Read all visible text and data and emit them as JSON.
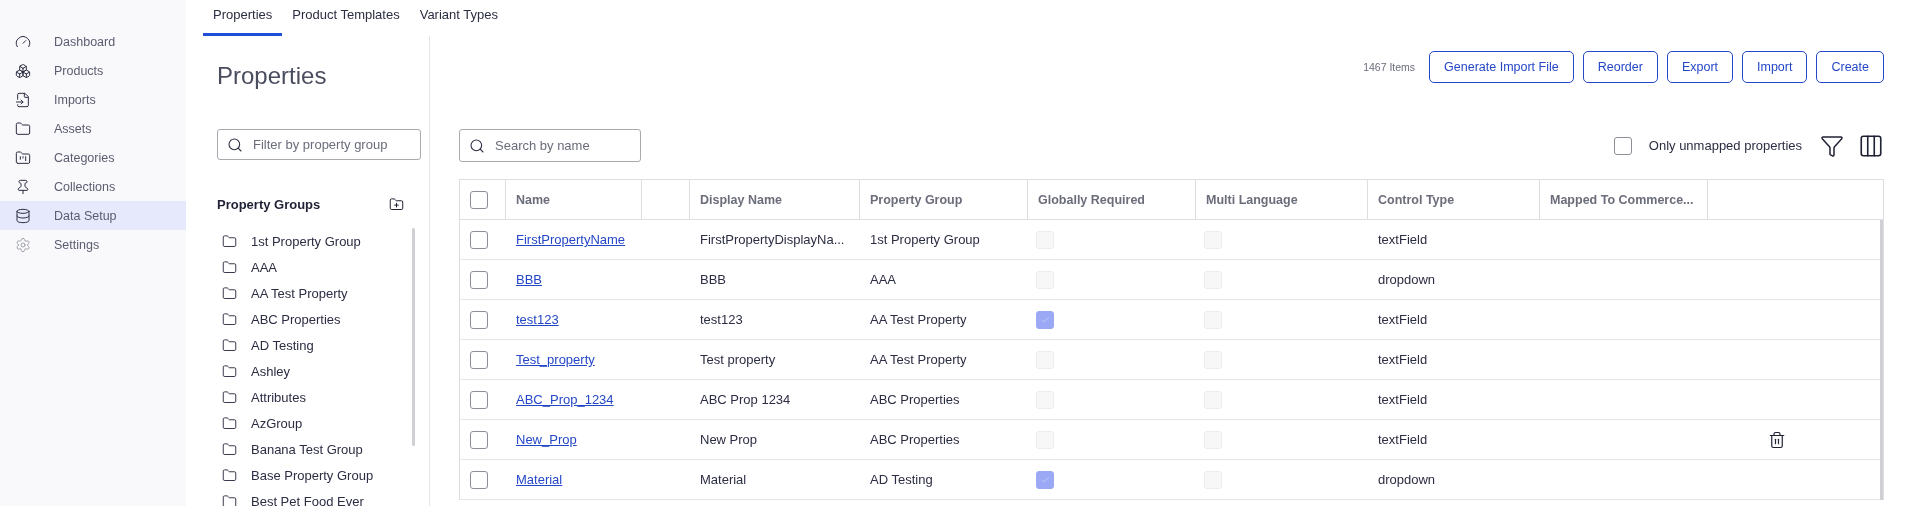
{
  "sidebar": {
    "items": [
      {
        "label": "Dashboard",
        "selected": false
      },
      {
        "label": "Products",
        "selected": false
      },
      {
        "label": "Imports",
        "selected": false
      },
      {
        "label": "Assets",
        "selected": false
      },
      {
        "label": "Categories",
        "selected": false
      },
      {
        "label": "Collections",
        "selected": false
      },
      {
        "label": "Data Setup",
        "selected": true
      },
      {
        "label": "Settings",
        "selected": false
      }
    ]
  },
  "tabs": [
    {
      "label": "Properties",
      "selected": true
    },
    {
      "label": "Product Templates",
      "selected": false
    },
    {
      "label": "Variant Types",
      "selected": false
    }
  ],
  "groups_panel": {
    "title": "Properties",
    "filter": {
      "placeholder": "Filter by property group"
    },
    "heading": "Property Groups",
    "groups": [
      "1st Property Group",
      "AAA",
      "AA Test Property",
      "ABC Properties",
      "AD Testing",
      "Ashley",
      "Attributes",
      "AzGroup",
      "Banana Test Group",
      "Base Property Group",
      "Best Pet Food Ever"
    ]
  },
  "toolbar": {
    "count": "1467 Items",
    "buttons": [
      "Generate Import File",
      "Reorder",
      "Export",
      "Import",
      "Create"
    ]
  },
  "search": {
    "placeholder": "Search by name"
  },
  "unmapped_filter": {
    "label": "Only unmapped properties",
    "checked": false
  },
  "table": {
    "all_selected": false,
    "columns": [
      "Name",
      "Display Name",
      "Property Group",
      "Globally Required",
      "Multi Language",
      "Control Type",
      "Mapped To Commerce..."
    ],
    "rows": [
      {
        "selected": false,
        "name": "FirstPropertyName",
        "display_name": "FirstPropertyDisplayNa...",
        "property_group": "1st Property Group",
        "globally_required": false,
        "multi_language": false,
        "control_type": "textField",
        "show_delete": false
      },
      {
        "selected": false,
        "name": "BBB",
        "display_name": "BBB",
        "property_group": "AAA",
        "globally_required": false,
        "multi_language": false,
        "control_type": "dropdown",
        "show_delete": false
      },
      {
        "selected": false,
        "name": "test123",
        "display_name": "test123",
        "property_group": "AA Test Property",
        "globally_required": true,
        "multi_language": false,
        "control_type": "textField",
        "show_delete": false
      },
      {
        "selected": false,
        "name": "Test_property",
        "display_name": "Test property",
        "property_group": "AA Test Property",
        "globally_required": false,
        "multi_language": false,
        "control_type": "textField",
        "show_delete": false
      },
      {
        "selected": false,
        "name": "ABC_Prop_1234",
        "display_name": "ABC Prop 1234",
        "property_group": "ABC Properties",
        "globally_required": false,
        "multi_language": false,
        "control_type": "textField",
        "show_delete": false
      },
      {
        "selected": false,
        "name": "New_Prop",
        "display_name": "New Prop",
        "property_group": "ABC Properties",
        "globally_required": false,
        "multi_language": false,
        "control_type": "textField",
        "show_delete": true
      },
      {
        "selected": false,
        "name": "Material",
        "display_name": "Material",
        "property_group": "AD Testing",
        "globally_required": true,
        "multi_language": false,
        "control_type": "dropdown",
        "show_delete": false
      }
    ]
  }
}
